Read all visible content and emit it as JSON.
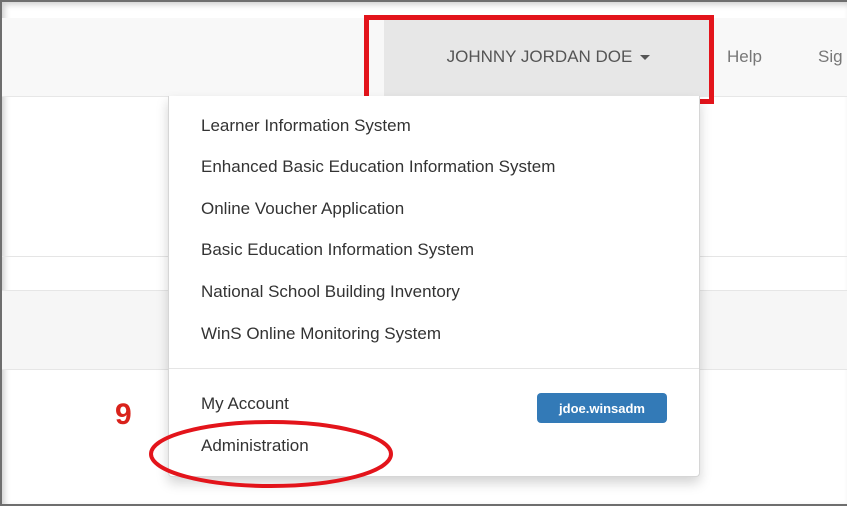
{
  "navbar": {
    "user_name": "JOHNNY JORDAN DOE",
    "help_label": "Help",
    "sign_out_label": "Sig"
  },
  "dropdown": {
    "systems": [
      "Learner Information System",
      "Enhanced Basic Education Information System",
      "Online Voucher Application",
      "Basic Education Information System",
      "National School Building Inventory",
      "WinS Online Monitoring System"
    ],
    "my_account_label": "My Account",
    "username_badge": "jdoe.winsadm",
    "administration_label": "Administration"
  },
  "annotation": {
    "step_number": "9",
    "highlight_color": "#e3141b"
  },
  "colors": {
    "navbar_bg": "#f8f8f8",
    "active_toggle_bg": "#e7e7e7",
    "badge_bg": "#337ab7"
  }
}
